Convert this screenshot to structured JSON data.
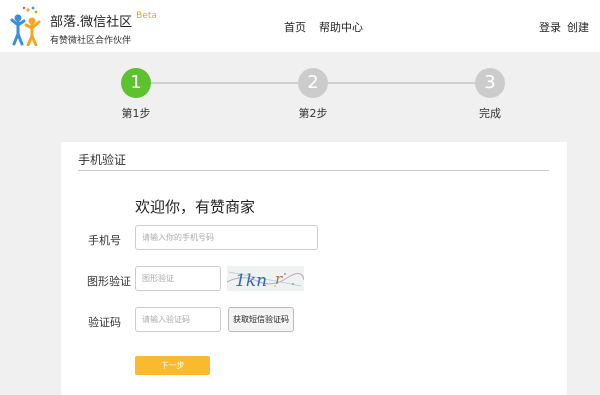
{
  "header": {
    "brand": "部落.微信社区",
    "beta": "Beta",
    "tagline": "有赞微社区合作伙伴",
    "nav": [
      {
        "label": "首页"
      },
      {
        "label": "帮助中心"
      }
    ],
    "login": "登录",
    "create": "创建"
  },
  "steps": [
    {
      "number": "1",
      "label": "第1步",
      "active": true
    },
    {
      "number": "2",
      "label": "第2步",
      "active": false
    },
    {
      "number": "3",
      "label": "完成",
      "active": false
    }
  ],
  "form": {
    "section_title": "手机验证",
    "welcome": "欢迎你，有赞商家",
    "phone_label": "手机号",
    "phone_placeholder": "请输入你的手机号码",
    "captcha_label": "图形验证",
    "captcha_placeholder": "图形验证",
    "captcha_text": "1kn",
    "sms_label": "验证码",
    "sms_placeholder": "请输入验证码",
    "sms_button": "获取短信验证码",
    "next_button": "下一步"
  },
  "colors": {
    "step_active": "#5cc22e",
    "step_inactive": "#cccccc",
    "next_button": "#fbb930",
    "beta": "#f0a030"
  }
}
